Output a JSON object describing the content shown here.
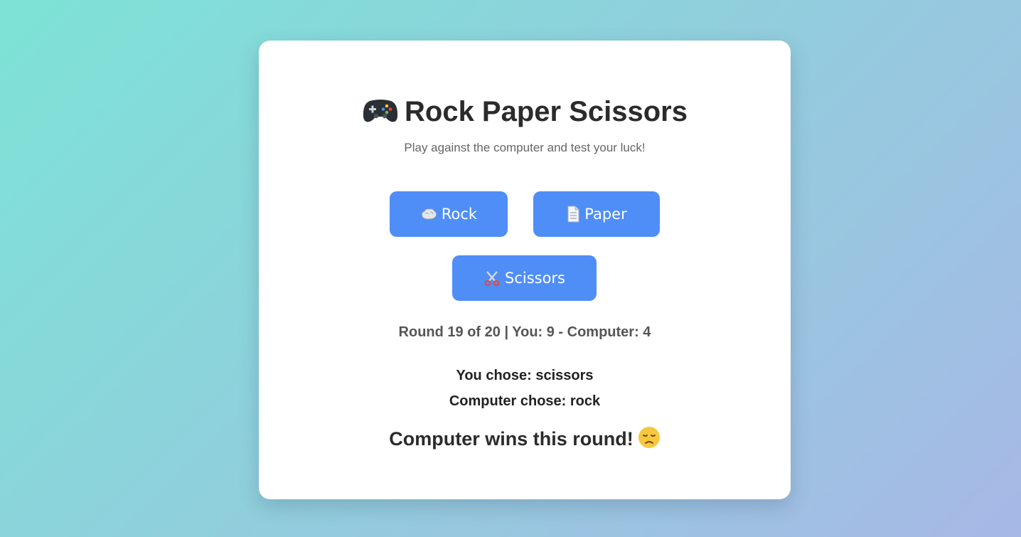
{
  "game": {
    "title": "Rock Paper Scissors",
    "title_icon": "gamepad-icon",
    "subtitle": "Play against the computer and test your luck!",
    "buttons": [
      {
        "label": "Rock",
        "icon": "rock-icon"
      },
      {
        "label": "Paper",
        "icon": "paper-icon"
      },
      {
        "label": "Scissors",
        "icon": "scissors-icon"
      }
    ],
    "score_line": "Round 19 of 20 | You: 9 - Computer: 4",
    "round": 19,
    "total_rounds": 20,
    "score_you": 9,
    "score_computer": 4,
    "you_chose": "You chose: scissors",
    "computer_chose": "Computer chose: rock",
    "result": "Computer wins this round!",
    "result_icon": "disappointed-face-icon"
  },
  "colors": {
    "button_bg": "#4f8ef7",
    "background_start": "#7de3d6",
    "background_end": "#a7b8e6"
  }
}
